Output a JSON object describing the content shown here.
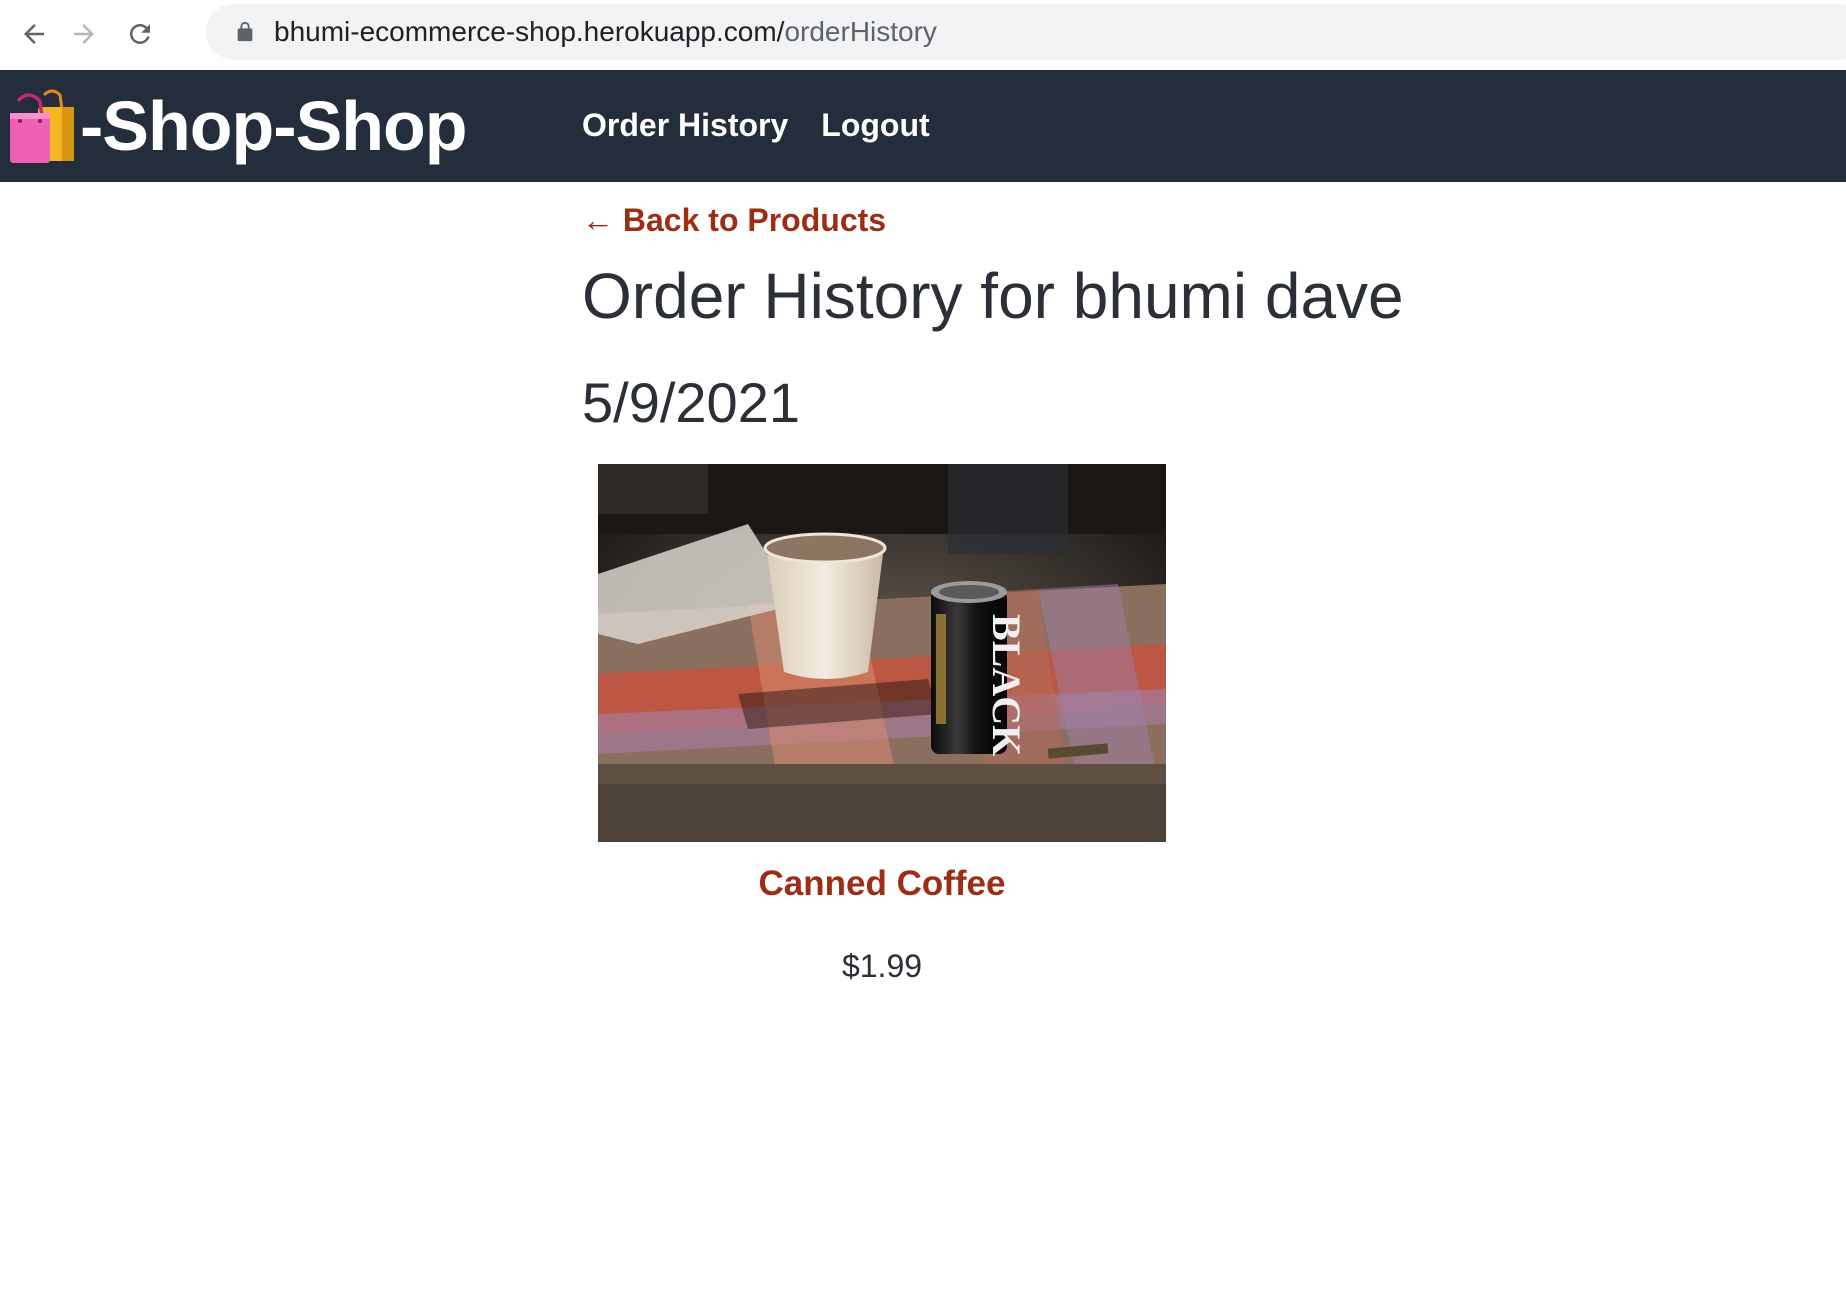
{
  "browser": {
    "url_host": "bhumi-ecommerce-shop.herokuapp.com/",
    "url_path": "orderHistory",
    "back_icon": "arrow-left-icon",
    "forward_icon": "arrow-right-icon",
    "reload_icon": "reload-icon",
    "lock_icon": "lock-icon"
  },
  "header": {
    "logo_icon": "shopping-bags-icon",
    "logo_text": "-Shop-Shop",
    "nav": {
      "order_history": "Order History",
      "logout": "Logout"
    },
    "background_color": "#242d3b"
  },
  "main": {
    "back_link": "← Back to Products",
    "title": "Order History for bhumi dave",
    "orders": [
      {
        "date": "5/9/2021",
        "products": [
          {
            "name": "Canned Coffee",
            "price": "$1.99",
            "image_alt": "Canned Coffee"
          }
        ]
      }
    ],
    "accent_color": "#9e2d16"
  }
}
